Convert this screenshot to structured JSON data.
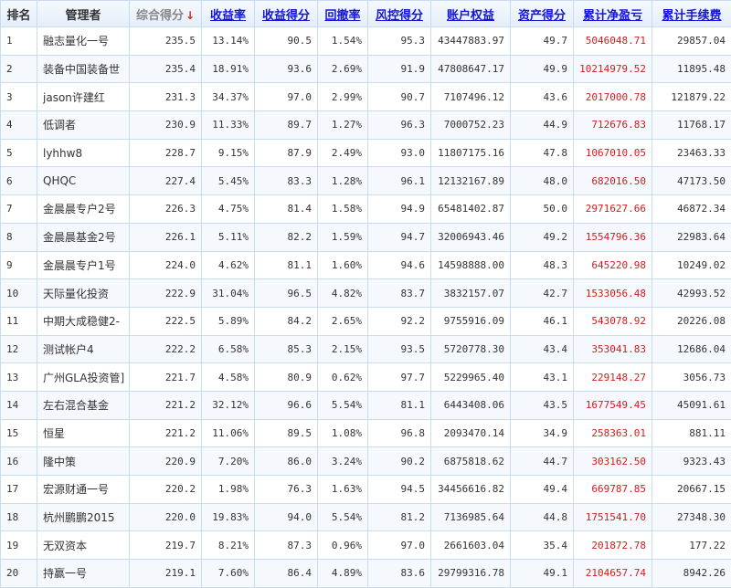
{
  "columns": [
    {
      "label": "排名",
      "sortable": false
    },
    {
      "label": "管理者",
      "sortable": false
    },
    {
      "label": "综合得分",
      "sortable": true,
      "sorted": true
    },
    {
      "label": "收益率",
      "sortable": true
    },
    {
      "label": "收益得分",
      "sortable": true
    },
    {
      "label": "回撤率",
      "sortable": true
    },
    {
      "label": "风控得分",
      "sortable": true
    },
    {
      "label": "账户权益",
      "sortable": true
    },
    {
      "label": "资产得分",
      "sortable": true
    },
    {
      "label": "累计净盈亏",
      "sortable": true
    },
    {
      "label": "累计手续费",
      "sortable": true
    }
  ],
  "sort_arrow": "↓",
  "colors": {
    "header_link": "#1515d6",
    "profit": "#d41c1c",
    "border": "#c9dcef"
  },
  "rows": [
    {
      "rank": "1",
      "name": "融志量化一号",
      "score": "235.5",
      "return_rate": "13.14%",
      "return_score": "90.5",
      "drawdown": "1.54%",
      "risk_score": "95.3",
      "equity": "43447883.97",
      "asset_score": "49.7",
      "net_profit": "5046048.71",
      "fees": "29857.04"
    },
    {
      "rank": "2",
      "name": "装备中国装备世",
      "score": "235.4",
      "return_rate": "18.91%",
      "return_score": "93.6",
      "drawdown": "2.69%",
      "risk_score": "91.9",
      "equity": "47808647.17",
      "asset_score": "49.9",
      "net_profit": "10214979.52",
      "fees": "11895.48"
    },
    {
      "rank": "3",
      "name": "jason许建红",
      "score": "231.3",
      "return_rate": "34.37%",
      "return_score": "97.0",
      "drawdown": "2.99%",
      "risk_score": "90.7",
      "equity": "7107496.12",
      "asset_score": "43.6",
      "net_profit": "2017000.78",
      "fees": "121879.22"
    },
    {
      "rank": "4",
      "name": "低调者",
      "score": "230.9",
      "return_rate": "11.33%",
      "return_score": "89.7",
      "drawdown": "1.27%",
      "risk_score": "96.3",
      "equity": "7000752.23",
      "asset_score": "44.9",
      "net_profit": "712676.83",
      "fees": "11768.17"
    },
    {
      "rank": "5",
      "name": "lyhhw8",
      "score": "228.7",
      "return_rate": "9.15%",
      "return_score": "87.9",
      "drawdown": "2.49%",
      "risk_score": "93.0",
      "equity": "11807175.16",
      "asset_score": "47.8",
      "net_profit": "1067010.05",
      "fees": "23463.33"
    },
    {
      "rank": "6",
      "name": "QHQC",
      "score": "227.4",
      "return_rate": "5.45%",
      "return_score": "83.3",
      "drawdown": "1.28%",
      "risk_score": "96.1",
      "equity": "12132167.89",
      "asset_score": "48.0",
      "net_profit": "682016.50",
      "fees": "47173.50"
    },
    {
      "rank": "7",
      "name": "金晨晨专户2号",
      "score": "226.3",
      "return_rate": "4.75%",
      "return_score": "81.4",
      "drawdown": "1.58%",
      "risk_score": "94.9",
      "equity": "65481402.87",
      "asset_score": "50.0",
      "net_profit": "2971627.66",
      "fees": "46872.34"
    },
    {
      "rank": "8",
      "name": "金晨晨基金2号",
      "score": "226.1",
      "return_rate": "5.11%",
      "return_score": "82.2",
      "drawdown": "1.59%",
      "risk_score": "94.7",
      "equity": "32006943.46",
      "asset_score": "49.2",
      "net_profit": "1554796.36",
      "fees": "22983.64"
    },
    {
      "rank": "9",
      "name": "金晨晨专户1号",
      "score": "224.0",
      "return_rate": "4.62%",
      "return_score": "81.1",
      "drawdown": "1.60%",
      "risk_score": "94.6",
      "equity": "14598888.00",
      "asset_score": "48.3",
      "net_profit": "645220.98",
      "fees": "10249.02"
    },
    {
      "rank": "10",
      "name": "天际量化投资",
      "score": "222.9",
      "return_rate": "31.04%",
      "return_score": "96.5",
      "drawdown": "4.82%",
      "risk_score": "83.7",
      "equity": "3832157.07",
      "asset_score": "42.7",
      "net_profit": "1533056.48",
      "fees": "42993.52"
    },
    {
      "rank": "11",
      "name": "中期大成稳健2-",
      "score": "222.5",
      "return_rate": "5.89%",
      "return_score": "84.2",
      "drawdown": "2.65%",
      "risk_score": "92.2",
      "equity": "9755916.09",
      "asset_score": "46.1",
      "net_profit": "543078.92",
      "fees": "20226.08"
    },
    {
      "rank": "12",
      "name": "测试帐户4",
      "score": "222.2",
      "return_rate": "6.58%",
      "return_score": "85.3",
      "drawdown": "2.15%",
      "risk_score": "93.5",
      "equity": "5720778.30",
      "asset_score": "43.4",
      "net_profit": "353041.83",
      "fees": "12686.04"
    },
    {
      "rank": "13",
      "name": "广州GLA投资管]",
      "score": "221.7",
      "return_rate": "4.58%",
      "return_score": "80.9",
      "drawdown": "0.62%",
      "risk_score": "97.7",
      "equity": "5229965.40",
      "asset_score": "43.1",
      "net_profit": "229148.27",
      "fees": "3056.73"
    },
    {
      "rank": "14",
      "name": "左右混合基金",
      "score": "221.2",
      "return_rate": "32.12%",
      "return_score": "96.6",
      "drawdown": "5.54%",
      "risk_score": "81.1",
      "equity": "6443408.06",
      "asset_score": "43.5",
      "net_profit": "1677549.45",
      "fees": "45091.61"
    },
    {
      "rank": "15",
      "name": "恒星",
      "score": "221.2",
      "return_rate": "11.06%",
      "return_score": "89.5",
      "drawdown": "1.08%",
      "risk_score": "96.8",
      "equity": "2093470.14",
      "asset_score": "34.9",
      "net_profit": "258363.01",
      "fees": "881.11"
    },
    {
      "rank": "16",
      "name": "隆中策",
      "score": "220.9",
      "return_rate": "7.20%",
      "return_score": "86.0",
      "drawdown": "3.24%",
      "risk_score": "90.2",
      "equity": "6875818.62",
      "asset_score": "44.7",
      "net_profit": "303162.50",
      "fees": "9323.43"
    },
    {
      "rank": "17",
      "name": "宏源财通一号",
      "score": "220.2",
      "return_rate": "1.98%",
      "return_score": "76.3",
      "drawdown": "1.63%",
      "risk_score": "94.5",
      "equity": "34456616.82",
      "asset_score": "49.4",
      "net_profit": "669787.85",
      "fees": "20667.15"
    },
    {
      "rank": "18",
      "name": "杭州鹏鹏2015",
      "score": "220.0",
      "return_rate": "19.83%",
      "return_score": "94.0",
      "drawdown": "5.54%",
      "risk_score": "81.2",
      "equity": "7136985.64",
      "asset_score": "44.8",
      "net_profit": "1751541.70",
      "fees": "27348.30"
    },
    {
      "rank": "19",
      "name": "无双资本",
      "score": "219.7",
      "return_rate": "8.21%",
      "return_score": "87.3",
      "drawdown": "0.96%",
      "risk_score": "97.0",
      "equity": "2661603.04",
      "asset_score": "35.4",
      "net_profit": "201872.78",
      "fees": "177.22"
    },
    {
      "rank": "20",
      "name": "持赢一号",
      "score": "219.1",
      "return_rate": "7.60%",
      "return_score": "86.4",
      "drawdown": "4.89%",
      "risk_score": "83.6",
      "equity": "29799316.78",
      "asset_score": "49.1",
      "net_profit": "2104657.74",
      "fees": "8942.26"
    }
  ]
}
